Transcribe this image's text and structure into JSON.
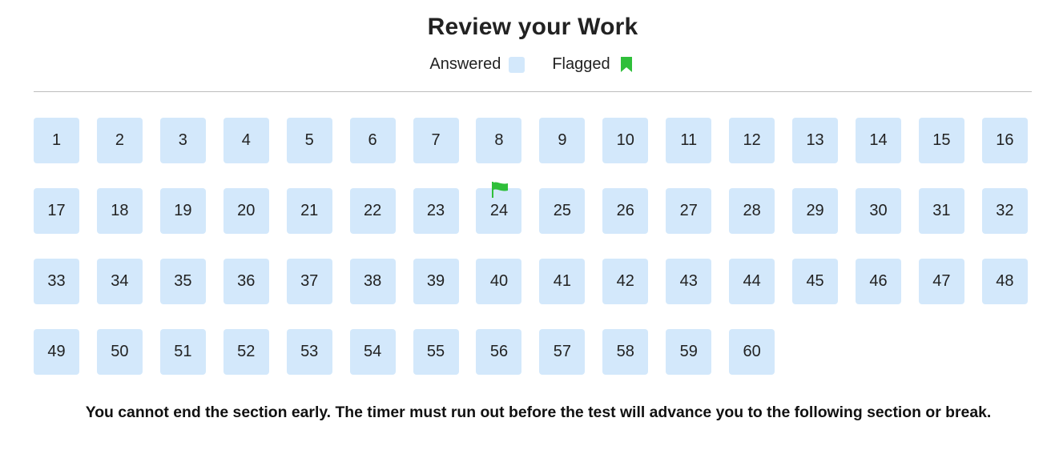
{
  "header": {
    "title": "Review your Work"
  },
  "legend": {
    "answered_label": "Answered",
    "answered_color": "#d3e8fb",
    "flagged_label": "Flagged",
    "flag_color": "#2fbf3a",
    "flag_icon": "bookmark-icon"
  },
  "questions": [
    {
      "number": "1",
      "answered": true,
      "flagged": false
    },
    {
      "number": "2",
      "answered": true,
      "flagged": false
    },
    {
      "number": "3",
      "answered": true,
      "flagged": false
    },
    {
      "number": "4",
      "answered": true,
      "flagged": false
    },
    {
      "number": "5",
      "answered": true,
      "flagged": false
    },
    {
      "number": "6",
      "answered": true,
      "flagged": false
    },
    {
      "number": "7",
      "answered": true,
      "flagged": false
    },
    {
      "number": "8",
      "answered": true,
      "flagged": false
    },
    {
      "number": "9",
      "answered": true,
      "flagged": false
    },
    {
      "number": "10",
      "answered": true,
      "flagged": false
    },
    {
      "number": "11",
      "answered": true,
      "flagged": false
    },
    {
      "number": "12",
      "answered": true,
      "flagged": false
    },
    {
      "number": "13",
      "answered": true,
      "flagged": false
    },
    {
      "number": "14",
      "answered": true,
      "flagged": false
    },
    {
      "number": "15",
      "answered": true,
      "flagged": false
    },
    {
      "number": "16",
      "answered": true,
      "flagged": false
    },
    {
      "number": "17",
      "answered": true,
      "flagged": false
    },
    {
      "number": "18",
      "answered": true,
      "flagged": false
    },
    {
      "number": "19",
      "answered": true,
      "flagged": false
    },
    {
      "number": "20",
      "answered": true,
      "flagged": false
    },
    {
      "number": "21",
      "answered": true,
      "flagged": false
    },
    {
      "number": "22",
      "answered": true,
      "flagged": false
    },
    {
      "number": "23",
      "answered": true,
      "flagged": false
    },
    {
      "number": "24",
      "answered": true,
      "flagged": true
    },
    {
      "number": "25",
      "answered": true,
      "flagged": false
    },
    {
      "number": "26",
      "answered": true,
      "flagged": false
    },
    {
      "number": "27",
      "answered": true,
      "flagged": false
    },
    {
      "number": "28",
      "answered": true,
      "flagged": false
    },
    {
      "number": "29",
      "answered": true,
      "flagged": false
    },
    {
      "number": "30",
      "answered": true,
      "flagged": false
    },
    {
      "number": "31",
      "answered": true,
      "flagged": false
    },
    {
      "number": "32",
      "answered": true,
      "flagged": false
    },
    {
      "number": "33",
      "answered": true,
      "flagged": false
    },
    {
      "number": "34",
      "answered": true,
      "flagged": false
    },
    {
      "number": "35",
      "answered": true,
      "flagged": false
    },
    {
      "number": "36",
      "answered": true,
      "flagged": false
    },
    {
      "number": "37",
      "answered": true,
      "flagged": false
    },
    {
      "number": "38",
      "answered": true,
      "flagged": false
    },
    {
      "number": "39",
      "answered": true,
      "flagged": false
    },
    {
      "number": "40",
      "answered": true,
      "flagged": false
    },
    {
      "number": "41",
      "answered": true,
      "flagged": false
    },
    {
      "number": "42",
      "answered": true,
      "flagged": false
    },
    {
      "number": "43",
      "answered": true,
      "flagged": false
    },
    {
      "number": "44",
      "answered": true,
      "flagged": false
    },
    {
      "number": "45",
      "answered": true,
      "flagged": false
    },
    {
      "number": "46",
      "answered": true,
      "flagged": false
    },
    {
      "number": "47",
      "answered": true,
      "flagged": false
    },
    {
      "number": "48",
      "answered": true,
      "flagged": false
    },
    {
      "number": "49",
      "answered": true,
      "flagged": false
    },
    {
      "number": "50",
      "answered": true,
      "flagged": false
    },
    {
      "number": "51",
      "answered": true,
      "flagged": false
    },
    {
      "number": "52",
      "answered": true,
      "flagged": false
    },
    {
      "number": "53",
      "answered": true,
      "flagged": false
    },
    {
      "number": "54",
      "answered": true,
      "flagged": false
    },
    {
      "number": "55",
      "answered": true,
      "flagged": false
    },
    {
      "number": "56",
      "answered": true,
      "flagged": false
    },
    {
      "number": "57",
      "answered": true,
      "flagged": false
    },
    {
      "number": "58",
      "answered": true,
      "flagged": false
    },
    {
      "number": "59",
      "answered": true,
      "flagged": false
    },
    {
      "number": "60",
      "answered": true,
      "flagged": false
    }
  ],
  "question_flag_icon": "flag-icon",
  "footer": {
    "notice": "You cannot end the section early. The timer must run out before the test will advance you to the following section or break."
  }
}
